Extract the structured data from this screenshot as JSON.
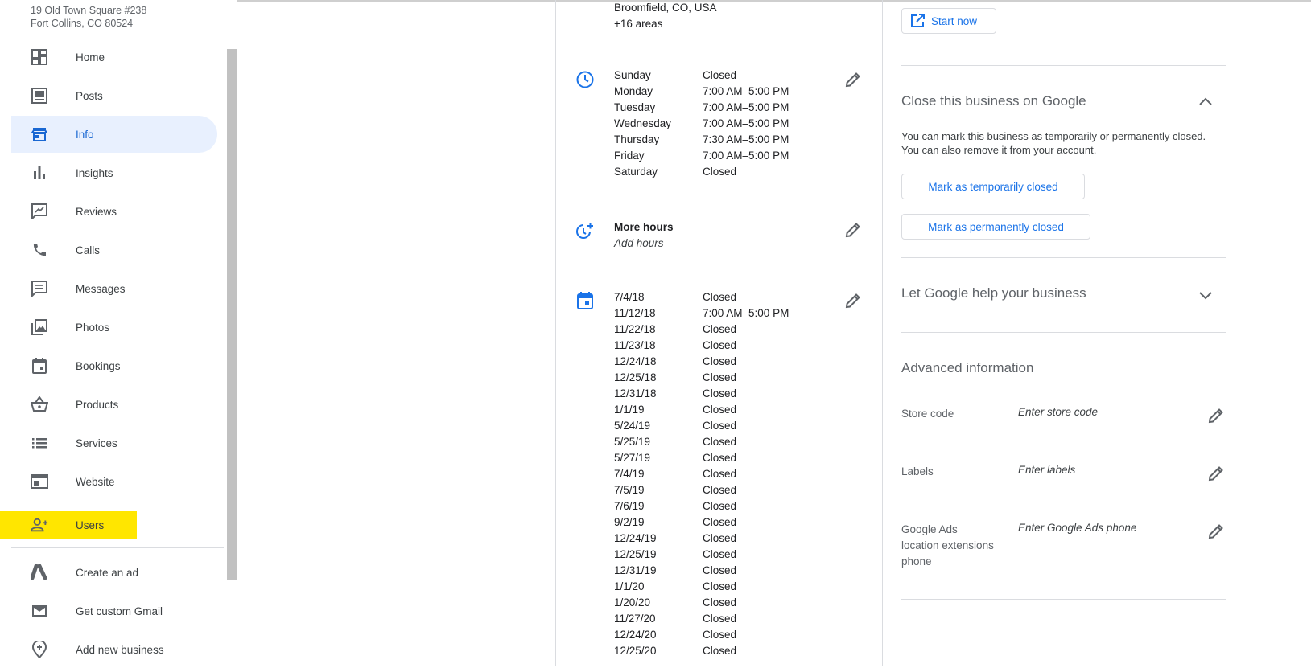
{
  "sidebar": {
    "address": [
      "19 Old Town Square #238",
      "Fort Collins, CO 80524"
    ],
    "items": [
      {
        "label": "Home",
        "icon": "dashboard-icon"
      },
      {
        "label": "Posts",
        "icon": "posts-icon"
      },
      {
        "label": "Info",
        "icon": "storefront-icon",
        "active": true
      },
      {
        "label": "Insights",
        "icon": "bar-chart-icon"
      },
      {
        "label": "Reviews",
        "icon": "reviews-icon"
      },
      {
        "label": "Calls",
        "icon": "phone-icon"
      },
      {
        "label": "Messages",
        "icon": "message-icon"
      },
      {
        "label": "Photos",
        "icon": "photos-icon"
      },
      {
        "label": "Bookings",
        "icon": "calendar-icon"
      },
      {
        "label": "Products",
        "icon": "basket-icon"
      },
      {
        "label": "Services",
        "icon": "list-icon"
      },
      {
        "label": "Website",
        "icon": "website-icon"
      },
      {
        "label": "Users",
        "icon": "add-user-icon",
        "highlighted": true
      }
    ],
    "extra_items": [
      {
        "label": "Create an ad",
        "icon": "google-ads-icon"
      },
      {
        "label": "Get custom Gmail",
        "icon": "gmail-icon"
      },
      {
        "label": "Add new business",
        "icon": "add-location-icon"
      }
    ]
  },
  "service_area": {
    "location": "Broomfield, CO, USA",
    "more": "+16 areas"
  },
  "hours": [
    {
      "day": "Sunday",
      "time": "Closed"
    },
    {
      "day": "Monday",
      "time": "7:00 AM–5:00 PM"
    },
    {
      "day": "Tuesday",
      "time": "7:00 AM–5:00 PM"
    },
    {
      "day": "Wednesday",
      "time": "7:00 AM–5:00 PM"
    },
    {
      "day": "Thursday",
      "time": "7:30 AM–5:00 PM"
    },
    {
      "day": "Friday",
      "time": "7:00 AM–5:00 PM"
    },
    {
      "day": "Saturday",
      "time": "Closed"
    }
  ],
  "more_hours": {
    "title": "More hours",
    "placeholder": "Add hours"
  },
  "special_hours": [
    {
      "date": "7/4/18",
      "time": "Closed"
    },
    {
      "date": "11/12/18",
      "time": "7:00 AM–5:00 PM"
    },
    {
      "date": "11/22/18",
      "time": "Closed"
    },
    {
      "date": "11/23/18",
      "time": "Closed"
    },
    {
      "date": "12/24/18",
      "time": "Closed"
    },
    {
      "date": "12/25/18",
      "time": "Closed"
    },
    {
      "date": "12/31/18",
      "time": "Closed"
    },
    {
      "date": "1/1/19",
      "time": "Closed"
    },
    {
      "date": "5/24/19",
      "time": "Closed"
    },
    {
      "date": "5/25/19",
      "time": "Closed"
    },
    {
      "date": "5/27/19",
      "time": "Closed"
    },
    {
      "date": "7/4/19",
      "time": "Closed"
    },
    {
      "date": "7/5/19",
      "time": "Closed"
    },
    {
      "date": "7/6/19",
      "time": "Closed"
    },
    {
      "date": "9/2/19",
      "time": "Closed"
    },
    {
      "date": "12/24/19",
      "time": "Closed"
    },
    {
      "date": "12/25/19",
      "time": "Closed"
    },
    {
      "date": "12/31/19",
      "time": "Closed"
    },
    {
      "date": "1/1/20",
      "time": "Closed"
    },
    {
      "date": "1/20/20",
      "time": "Closed"
    },
    {
      "date": "11/27/20",
      "time": "Closed"
    },
    {
      "date": "12/24/20",
      "time": "Closed"
    },
    {
      "date": "12/25/20",
      "time": "Closed"
    }
  ],
  "right": {
    "start_now": "Start now",
    "close_section": {
      "title": "Close this business on Google",
      "description": "You can mark this business as temporarily or permanently closed. You can also remove it from your account.",
      "temp_button": "Mark as temporarily closed",
      "perm_button": "Mark as permanently closed"
    },
    "help_section": {
      "title": "Let Google help your business"
    },
    "advanced": {
      "title": "Advanced information",
      "fields": [
        {
          "label": "Store code",
          "placeholder": "Enter store code"
        },
        {
          "label": "Labels",
          "placeholder": "Enter labels"
        },
        {
          "label": "Google Ads location extensions phone",
          "placeholder": "Enter Google Ads phone"
        }
      ]
    }
  },
  "colors": {
    "accent": "#1a73e8",
    "active_bg": "#e8f0fe",
    "highlight": "#ffe600"
  }
}
